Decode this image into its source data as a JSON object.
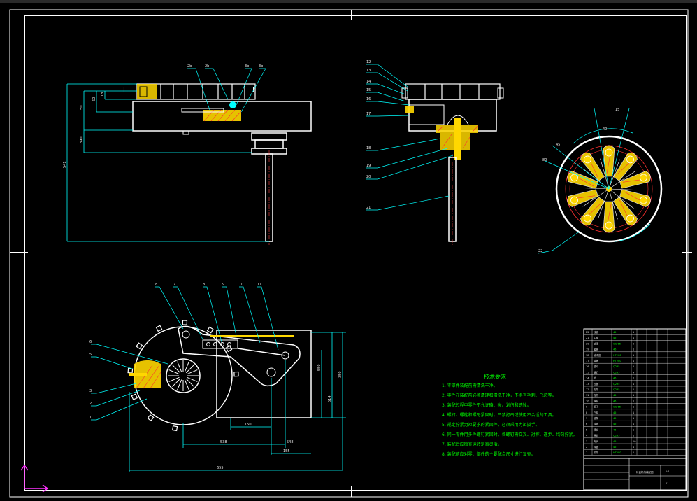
{
  "drawing": {
    "colors": {
      "background": "#000000",
      "frame": "#ffffff",
      "dimension": "#00ffff",
      "leader": "#00ffff",
      "part_fill": "#ffff00",
      "hatch": "#ff0000",
      "note_text": "#00ff00",
      "ucs": "#ff33ff"
    },
    "view_labels": {
      "section_left": "L",
      "section_right": "L"
    },
    "callouts_top_left": [
      "2b",
      "2b",
      "3b",
      "3b"
    ],
    "callouts_top_right": [
      "12",
      "13",
      "14",
      "15",
      "16",
      "17",
      "18",
      "19",
      "20",
      "21"
    ],
    "callouts_round": [
      "22"
    ],
    "callouts_bottom_top": [
      "8",
      "7",
      "8",
      "9",
      "10",
      "11"
    ],
    "callouts_bottom_left": [
      "6",
      "5",
      "3",
      "2",
      "1"
    ],
    "dims_top_left": [
      "18",
      "60",
      "150",
      "390",
      "541"
    ],
    "dims_round": [
      "15",
      "40",
      "45",
      "80"
    ],
    "dims_bottom": [
      "150",
      "538",
      "548",
      "550",
      "155",
      "514",
      "350",
      "655"
    ],
    "notes": {
      "title": "技术要求",
      "lines": [
        "1. 零部件装配前需清洗干净。",
        "2. 零件在装配前必须清理和清洗干净，不得有毛刺、飞边等。",
        "3. 装配过程中零件不允许磕、碰、划伤和锈蚀。",
        "4. 螺钉、螺栓和螺母紧固时，严禁打击或使用不合适的工具。",
        "5. 规定拧紧力矩要求的紧固件，必须采用力矩扳手。",
        "6. 同一零件用多件螺钉紧固时，各螺钉需交叉、对称、逐步、均匀拧紧。",
        "7. 装配后应检查运转是否灵活。",
        "8. 装配前应对零、部件的主要配合尺寸进行复查。"
      ]
    },
    "bom_rows": [
      [
        "22",
        "铰链",
        "1",
        "45"
      ],
      [
        "21",
        "主轴",
        "1",
        "45"
      ],
      [
        "20",
        "轴承",
        "2",
        "GCr15"
      ],
      [
        "19",
        "套筒",
        "1",
        "45"
      ],
      [
        "18",
        "轴承座",
        "1",
        "HT200"
      ],
      [
        "17",
        "端盖",
        "1",
        "HT200"
      ],
      [
        "16",
        "垫片",
        "2",
        "Q235"
      ],
      [
        "15",
        "螺钉",
        "4",
        "Q235"
      ],
      [
        "14",
        "销",
        "2",
        "45"
      ],
      [
        "13",
        "压板",
        "1",
        "Q235"
      ],
      [
        "12",
        "支架",
        "1",
        "Q235"
      ],
      [
        "11",
        "连杆",
        "1",
        "45"
      ],
      [
        "10",
        "摆杆",
        "1",
        "45"
      ],
      [
        "9",
        "滚子",
        "1",
        "GCr15"
      ],
      [
        "8",
        "凸轮",
        "1",
        "45"
      ],
      [
        "7",
        "链条",
        "1",
        "45"
      ],
      [
        "6",
        "拨盘",
        "1",
        "45"
      ],
      [
        "5",
        "槽轮",
        "1",
        "45"
      ],
      [
        "4",
        "导轨",
        "1",
        "Q235"
      ],
      [
        "3",
        "夹头",
        "10",
        "45"
      ],
      [
        "2",
        "转盘",
        "1",
        "45"
      ],
      [
        "1",
        "机架",
        "1",
        "HT200"
      ]
    ],
    "title_block": {
      "name": "转盘机构装配图",
      "scale": "1:1",
      "sheet": "A1"
    }
  }
}
